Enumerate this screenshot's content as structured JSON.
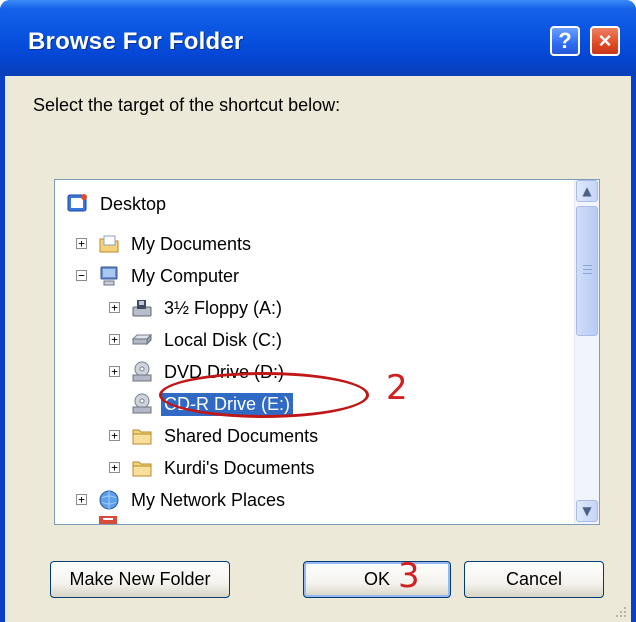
{
  "window": {
    "title": "Browse For Folder",
    "help_label": "?",
    "close_label": "×"
  },
  "instruction": "Select the target of the shortcut below:",
  "tree": {
    "items": [
      {
        "label": "Desktop",
        "icon": "desktop-icon",
        "expander": ""
      },
      {
        "label": "My Documents",
        "icon": "documents-icon",
        "expander": "+"
      },
      {
        "label": "My Computer",
        "icon": "computer-icon",
        "expander": "−"
      },
      {
        "label": "3½ Floppy (A:)",
        "icon": "floppy-icon",
        "expander": "+"
      },
      {
        "label": "Local Disk (C:)",
        "icon": "hard-disk-icon",
        "expander": "+"
      },
      {
        "label": "DVD Drive (D:)",
        "icon": "dvd-drive-icon",
        "expander": "+"
      },
      {
        "label": "CD-R Drive (E:)",
        "icon": "cd-drive-icon",
        "expander": "",
        "selected": true
      },
      {
        "label": "Shared Documents",
        "icon": "folder-icon",
        "expander": "+"
      },
      {
        "label": "Kurdi's Documents",
        "icon": "folder-icon",
        "expander": "+"
      },
      {
        "label": "My Network Places",
        "icon": "network-icon",
        "expander": "+"
      }
    ]
  },
  "buttons": {
    "new_folder": "Make New Folder",
    "ok": "OK",
    "cancel": "Cancel"
  },
  "annotations": {
    "step_2": "2",
    "step_3": "3"
  },
  "colors": {
    "title_bar": "#0a54e0",
    "selection": "#316ac5",
    "annotation": "#d02020",
    "dialog_bg": "#ece9d8"
  }
}
